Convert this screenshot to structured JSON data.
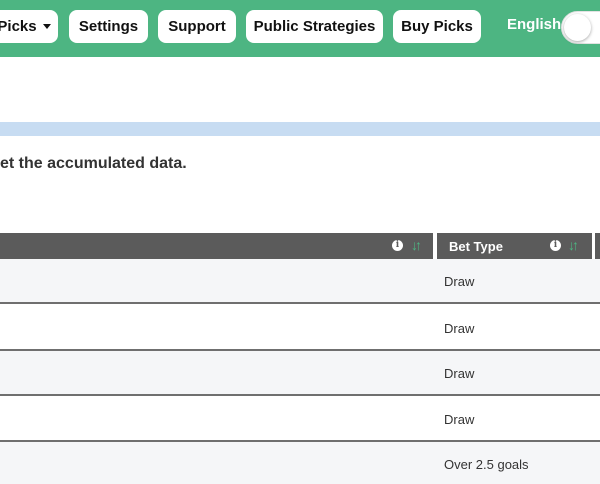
{
  "nav": {
    "buttons": [
      {
        "label": "Picks",
        "dropdown": true
      },
      {
        "label": "Settings"
      },
      {
        "label": "Support"
      },
      {
        "label": "Public Strategies"
      },
      {
        "label": "Buy Picks"
      }
    ],
    "language": "English",
    "toggle_on": false
  },
  "notice": "et the accumulated data.",
  "table": {
    "columns": [
      {
        "label": ""
      },
      {
        "label": "Bet Type"
      }
    ],
    "rows": [
      {
        "bet_type": "Draw"
      },
      {
        "bet_type": "Draw"
      },
      {
        "bet_type": "Draw"
      },
      {
        "bet_type": "Draw"
      },
      {
        "bet_type": "Over 2.5 goals"
      }
    ]
  },
  "colors": {
    "nav_bg": "#4db582",
    "header_bg": "#5b5b5b",
    "info_bar": "#c7dcf2",
    "sort_icon": "#4db582"
  }
}
